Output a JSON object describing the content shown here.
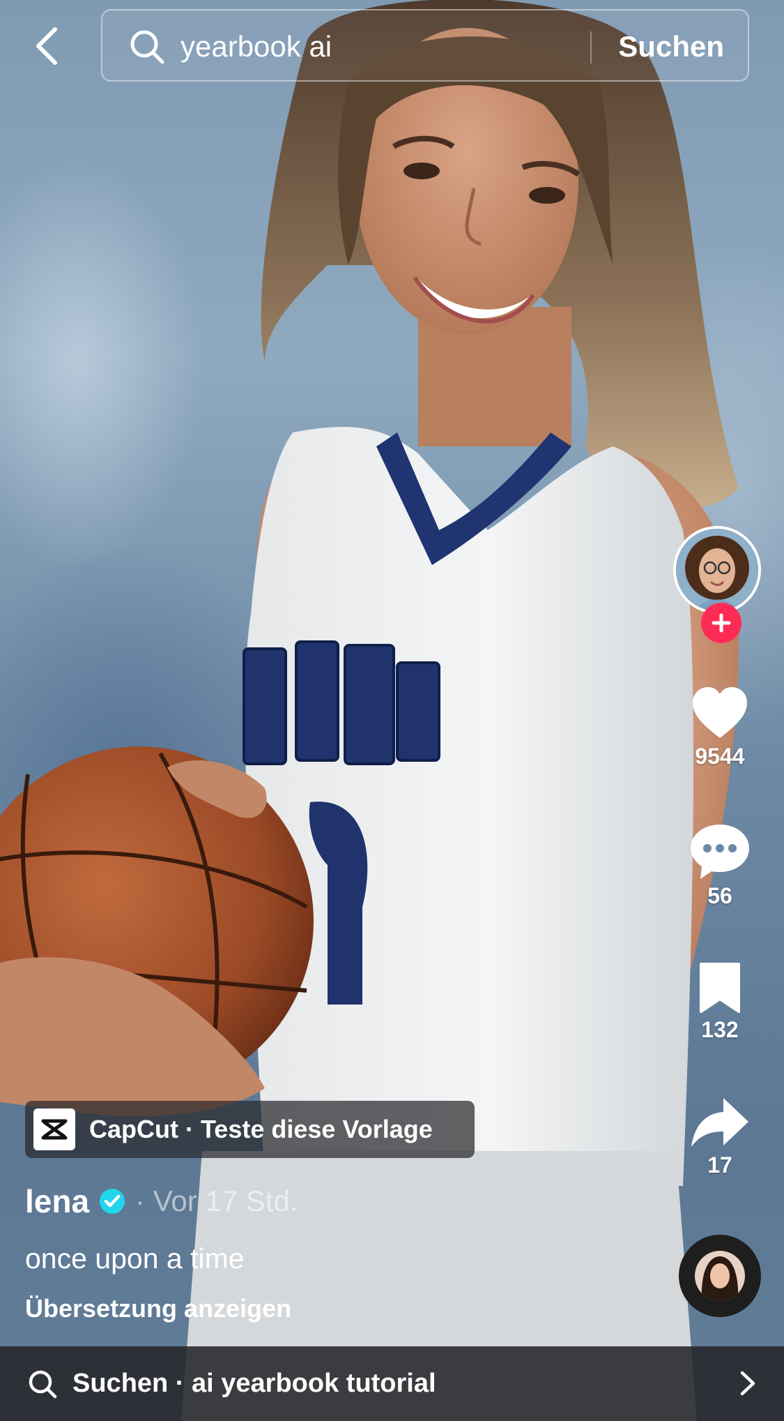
{
  "search": {
    "query": "yearbook ai",
    "submit_label": "Suchen"
  },
  "video": {
    "photo_subject": "Yearbook-style portrait of a smiling girl in a basketball jersey holding a basketball",
    "jersey_lettering": "CENTS",
    "jersey_number": "8"
  },
  "actions": {
    "likes": "9544",
    "comments": "56",
    "saves": "132",
    "shares": "17"
  },
  "template_chip": {
    "label": "CapCut · Teste diese Vorlage"
  },
  "author": {
    "name": "lena",
    "verified": true,
    "time": "· Vor 17 Std."
  },
  "caption": "once upon a time",
  "translate_label": "Übersetzung anzeigen",
  "suggestion": {
    "label": "Suchen · ai yearbook tutorial"
  },
  "icons": [
    "back-arrow-icon",
    "search-icon",
    "plus-icon",
    "heart-icon",
    "comment-icon",
    "bookmark-icon",
    "share-icon",
    "capcut-logo-icon",
    "verified-icon",
    "chevron-right-icon"
  ],
  "colors": {
    "follow_accent": "#fe2c55",
    "verified_badge": "#20d5ec"
  }
}
